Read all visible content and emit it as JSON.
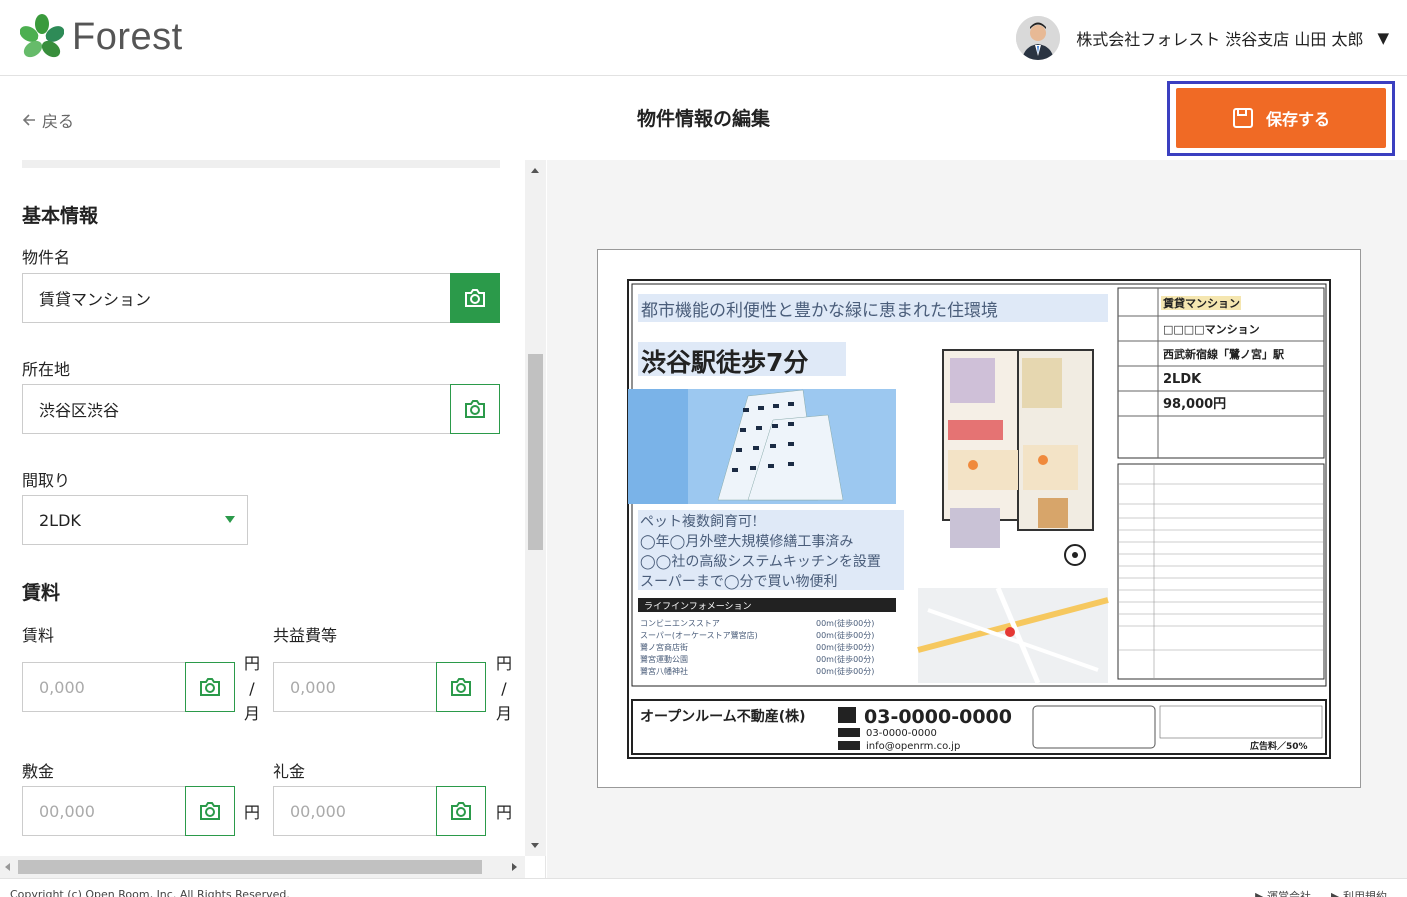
{
  "header": {
    "brand": "Forest",
    "user_name": "株式会社フォレスト 渋谷支店 山田 太郎",
    "caret": "▼"
  },
  "subheader": {
    "back_label": "戻る",
    "title": "物件情報の編集",
    "save_label": "保存する"
  },
  "form": {
    "section_basic": "基本情報",
    "property_name_label": "物件名",
    "property_name_value": "賃貸マンション",
    "address_label": "所在地",
    "address_value": "渋谷区渋谷",
    "layout_label": "間取り",
    "layout_value": "2LDK",
    "section_rent": "賃料",
    "rent_label": "賃料",
    "rent_placeholder": "0,000",
    "rent_unit": [
      "円",
      "/",
      "月"
    ],
    "common_fee_label": "共益費等",
    "common_fee_placeholder": "0,000",
    "common_fee_unit": [
      "円",
      "/",
      "月"
    ],
    "deposit_label": "敷金",
    "deposit_placeholder": "00,000",
    "deposit_unit": "円",
    "key_money_label": "礼金",
    "key_money_placeholder": "00,000",
    "key_money_unit": "円"
  },
  "flyer": {
    "headline": "都市機能の利便性と豊かな緑に恵まれた住環境",
    "walk": "渋谷駅徒歩7分",
    "features": [
      "ペット複数飼育可!",
      "◯年◯月外壁大規模修繕工事済み",
      "◯◯社の高級システムキッチンを設置",
      "スーパーまで◯分で買い物便利"
    ],
    "lifeinfo_title": "ライフインフォメーション",
    "lifeinfo": [
      {
        "name": "コンビニエンスストア",
        "dist": "00m(徒歩00分)"
      },
      {
        "name": "スーパー(オーケーストア鷺宮店)",
        "dist": "00m(徒歩00分)"
      },
      {
        "name": "鷺ノ宮商店街",
        "dist": "00m(徒歩00分)"
      },
      {
        "name": "鷺宮運動公園",
        "dist": "00m(徒歩00分)"
      },
      {
        "name": "鷺宮八幡神社",
        "dist": "00m(徒歩00分)"
      }
    ],
    "spec_type": "賃貸マンション",
    "spec_name": "□□□□マンション",
    "spec_station": "西武新宿線「鷺ノ宮」駅",
    "spec_layout": "2LDK",
    "spec_rent": "98,000円",
    "agency_name": "オープンルーム不動産(株)",
    "agency_tel": "03-0000-0000",
    "agency_fax": "03-0000-0000",
    "agency_mail": "info@openrm.co.jp",
    "fee_label": "広告料／50%"
  },
  "footer": {
    "copyright": "Copyright (c) Open Room, Inc. All Rights Reserved.",
    "links": [
      "▶ 運営会社",
      "▶ 利用規約"
    ]
  },
  "colors": {
    "accent_orange": "#f06a25",
    "brand_green": "#2b9a4a",
    "focus_outline": "#3b3fc0"
  }
}
